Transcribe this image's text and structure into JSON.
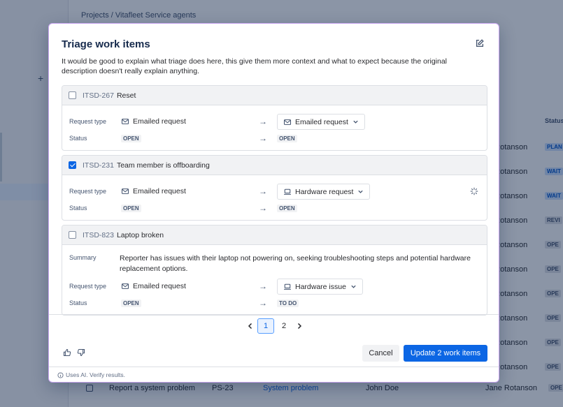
{
  "background": {
    "breadcrumb": "Projects  /  Vitafleet Service agents",
    "status_header": "Status",
    "rows": [
      {
        "name": "e Rotanson",
        "status": "PLAN",
        "blue": true
      },
      {
        "name": "e Rotanson",
        "status": "WAIT",
        "blue": true
      },
      {
        "name": "e Rotanson",
        "status": "WAIT",
        "blue": true
      },
      {
        "name": "e Rotanson",
        "status": "REVI",
        "blue": false
      },
      {
        "name": "e Rotanson",
        "status": "OPE",
        "blue": false
      },
      {
        "name": "e Rotanson",
        "status": "OPE",
        "blue": false
      },
      {
        "name": "e Rotanson",
        "status": "OPE",
        "blue": false
      },
      {
        "name": "e Rotanson",
        "status": "OPE",
        "blue": false
      },
      {
        "name": "e Rotanson",
        "status": "OPE",
        "blue": false
      },
      {
        "name": "e Rotanson",
        "status": "OPE",
        "blue": false
      }
    ],
    "last_row": {
      "summary": "Report a system problem",
      "key": "PS-23",
      "type": "System problem",
      "reporter": "John Doe",
      "assignee": "Jane Rotanson",
      "status": "OPE"
    }
  },
  "modal": {
    "title": "Triage work items",
    "description": "It would be good to explain what triage does here, this give them more context and what to expect because the original description doesn't really explain anything.",
    "items": [
      {
        "key": "ITSD-267",
        "title": "Reset",
        "checked": false,
        "request_type_label": "Request type",
        "status_label": "Status",
        "from_request_type": "Emailed request",
        "to_request_type": "Emailed request",
        "from_status": "OPEN",
        "to_status": "OPEN"
      },
      {
        "key": "ITSD-231",
        "title": "Team member is offboarding",
        "checked": true,
        "request_type_label": "Request type",
        "status_label": "Status",
        "from_request_type": "Emailed request",
        "to_request_type": "Hardware request",
        "from_status": "OPEN",
        "to_status": "OPEN"
      },
      {
        "key": "ITSD-823",
        "title": "Laptop broken",
        "checked": false,
        "summary_label": "Summary",
        "summary": "Reporter has issues with their laptop not powering on, seeking troubleshooting steps and potential hardware replacement options.",
        "request_type_label": "Request type",
        "status_label": "Status",
        "from_request_type": "Emailed request",
        "to_request_type": "Hardware issue",
        "from_status": "OPEN",
        "to_status": "TO DO"
      }
    ],
    "pagination": {
      "pages": [
        "1",
        "2"
      ],
      "current": "1"
    },
    "cancel_label": "Cancel",
    "primary_label": "Update 2 work items",
    "footer_note": "Uses AI. Verify results."
  }
}
